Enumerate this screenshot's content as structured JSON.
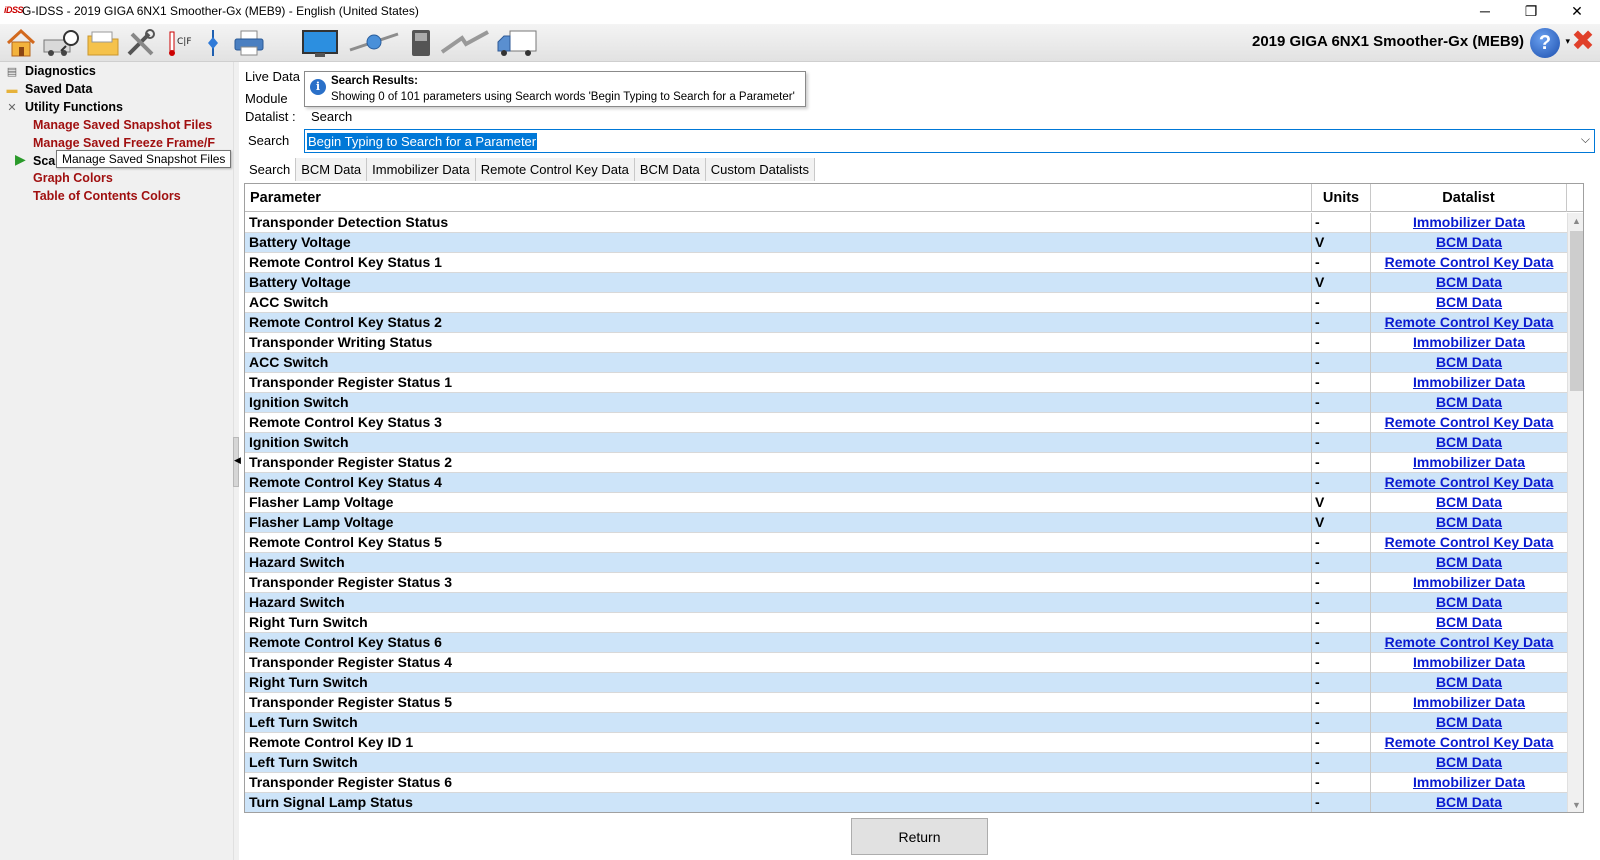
{
  "window": {
    "app_icon_text": "iDSS",
    "title": "G-IDSS - 2019 GIGA 6NX1 Smoother-Gx (MEB9) - English (United States)",
    "minimize": "─",
    "maximize": "❐",
    "close": "✕"
  },
  "toolbar": {
    "vehicle_title": "2019 GIGA 6NX1 Smoother-Gx (MEB9)",
    "temp_label": "C|F",
    "help_label": "?"
  },
  "sidebar": {
    "nodes": [
      {
        "label": "Diagnostics"
      },
      {
        "label": "Saved Data"
      },
      {
        "label": "Utility Functions"
      }
    ],
    "links": [
      {
        "label": "Manage Saved Snapshot Files"
      },
      {
        "label": "Manage Saved Freeze Frame/F"
      },
      {
        "label": "Sca"
      },
      {
        "label": "Graph Colors"
      },
      {
        "label": "Table of Contents Colors"
      }
    ],
    "tooltip": "Manage Saved Snapshot Files"
  },
  "header": {
    "live_data_label": "Live Data",
    "module_label": "Module",
    "datalist_label": "Datalist :",
    "datalist_value": "Search",
    "search_label": "Search"
  },
  "popup": {
    "title": "Search Results:",
    "body": "Showing 0 of 101 parameters using Search words 'Begin Typing to Search for a Parameter'"
  },
  "search": {
    "value": "Begin Typing to Search for a Parameter"
  },
  "tabs": [
    {
      "label": "Search",
      "active": true
    },
    {
      "label": "BCM Data"
    },
    {
      "label": "Immobilizer Data"
    },
    {
      "label": "Remote Control Key Data"
    },
    {
      "label": "BCM Data"
    },
    {
      "label": "Custom Datalists"
    }
  ],
  "grid": {
    "columns": [
      "Parameter",
      "Units",
      "Datalist"
    ],
    "rows": [
      {
        "parameter": "Transponder Detection Status",
        "units": "-",
        "datalist": "Immobilizer Data"
      },
      {
        "parameter": "Battery Voltage",
        "units": "V",
        "datalist": "BCM Data"
      },
      {
        "parameter": "Remote Control Key Status 1",
        "units": "-",
        "datalist": "Remote Control Key Data"
      },
      {
        "parameter": "Battery Voltage",
        "units": "V",
        "datalist": "BCM Data"
      },
      {
        "parameter": "ACC Switch",
        "units": "-",
        "datalist": "BCM Data"
      },
      {
        "parameter": "Remote Control Key Status 2",
        "units": "-",
        "datalist": "Remote Control Key Data"
      },
      {
        "parameter": "Transponder Writing Status",
        "units": "-",
        "datalist": "Immobilizer Data"
      },
      {
        "parameter": "ACC Switch",
        "units": "-",
        "datalist": "BCM Data"
      },
      {
        "parameter": "Transponder Register Status 1",
        "units": "-",
        "datalist": "Immobilizer Data"
      },
      {
        "parameter": "Ignition Switch",
        "units": "-",
        "datalist": "BCM Data"
      },
      {
        "parameter": "Remote Control Key Status 3",
        "units": "-",
        "datalist": "Remote Control Key Data"
      },
      {
        "parameter": "Ignition Switch",
        "units": "-",
        "datalist": "BCM Data"
      },
      {
        "parameter": "Transponder Register Status 2",
        "units": "-",
        "datalist": "Immobilizer Data"
      },
      {
        "parameter": "Remote Control Key Status 4",
        "units": "-",
        "datalist": "Remote Control Key Data"
      },
      {
        "parameter": "Flasher Lamp Voltage",
        "units": "V",
        "datalist": "BCM Data"
      },
      {
        "parameter": "Flasher Lamp Voltage",
        "units": "V",
        "datalist": "BCM Data"
      },
      {
        "parameter": "Remote Control Key Status 5",
        "units": "-",
        "datalist": "Remote Control Key Data"
      },
      {
        "parameter": "Hazard Switch",
        "units": "-",
        "datalist": "BCM Data"
      },
      {
        "parameter": "Transponder Register Status 3",
        "units": "-",
        "datalist": "Immobilizer Data"
      },
      {
        "parameter": "Hazard Switch",
        "units": "-",
        "datalist": "BCM Data"
      },
      {
        "parameter": "Right Turn Switch",
        "units": "-",
        "datalist": "BCM Data"
      },
      {
        "parameter": "Remote Control Key Status 6",
        "units": "-",
        "datalist": "Remote Control Key Data"
      },
      {
        "parameter": "Transponder Register Status 4",
        "units": "-",
        "datalist": "Immobilizer Data"
      },
      {
        "parameter": "Right Turn Switch",
        "units": "-",
        "datalist": "BCM Data"
      },
      {
        "parameter": "Transponder Register Status 5",
        "units": "-",
        "datalist": "Immobilizer Data"
      },
      {
        "parameter": "Left Turn Switch",
        "units": "-",
        "datalist": "BCM Data"
      },
      {
        "parameter": "Remote Control Key ID 1",
        "units": "-",
        "datalist": "Remote Control Key Data"
      },
      {
        "parameter": "Left Turn Switch",
        "units": "-",
        "datalist": "BCM Data"
      },
      {
        "parameter": "Transponder Register Status 6",
        "units": "-",
        "datalist": "Immobilizer Data"
      },
      {
        "parameter": "Turn Signal Lamp Status",
        "units": "-",
        "datalist": "BCM Data"
      }
    ]
  },
  "footer": {
    "return_label": "Return"
  },
  "colors": {
    "row_alt": "#cde4f9",
    "link": "#0a1bd0",
    "tree_link": "#a01010",
    "selection": "#0078d7"
  }
}
